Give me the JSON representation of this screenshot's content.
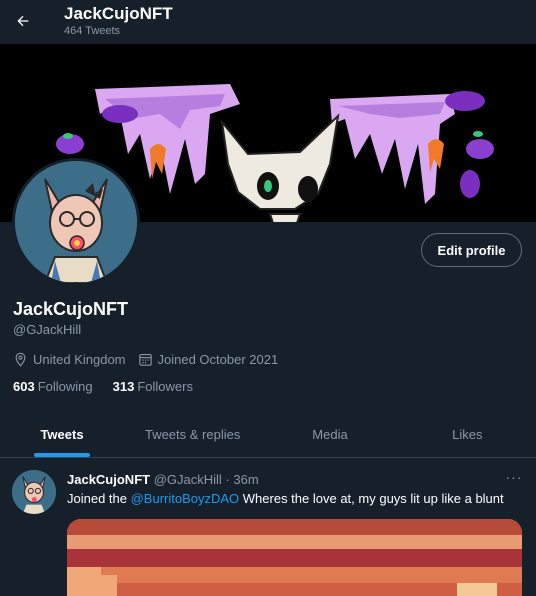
{
  "header": {
    "display_name": "JackCujoNFT",
    "tweet_count": "464 Tweets",
    "back_icon": "arrow-left-icon"
  },
  "profile": {
    "display_name": "JackCujoNFT",
    "handle": "@GJackHill",
    "edit_label": "Edit profile",
    "location": "United Kingdom",
    "joined": "Joined October 2021",
    "following_count": "603",
    "following_label": "Following",
    "followers_count": "313",
    "followers_label": "Followers"
  },
  "tabs": [
    {
      "label": "Tweets",
      "active": true
    },
    {
      "label": "Tweets & replies",
      "active": false
    },
    {
      "label": "Media",
      "active": false
    },
    {
      "label": "Likes",
      "active": false
    }
  ],
  "tweet": {
    "name": "JackCujoNFT",
    "handle": "@GJackHill",
    "sep": "·",
    "time": "36m",
    "more": "···",
    "text_before": "Joined the ",
    "mention": "@BurritoBoyzDAO",
    "text_after": " Wheres the love at, my guys lit up like a blunt"
  },
  "colors": {
    "background": "#15202b",
    "accent": "#1d9bf0",
    "muted": "#8b98a5",
    "divider": "#38444d"
  }
}
